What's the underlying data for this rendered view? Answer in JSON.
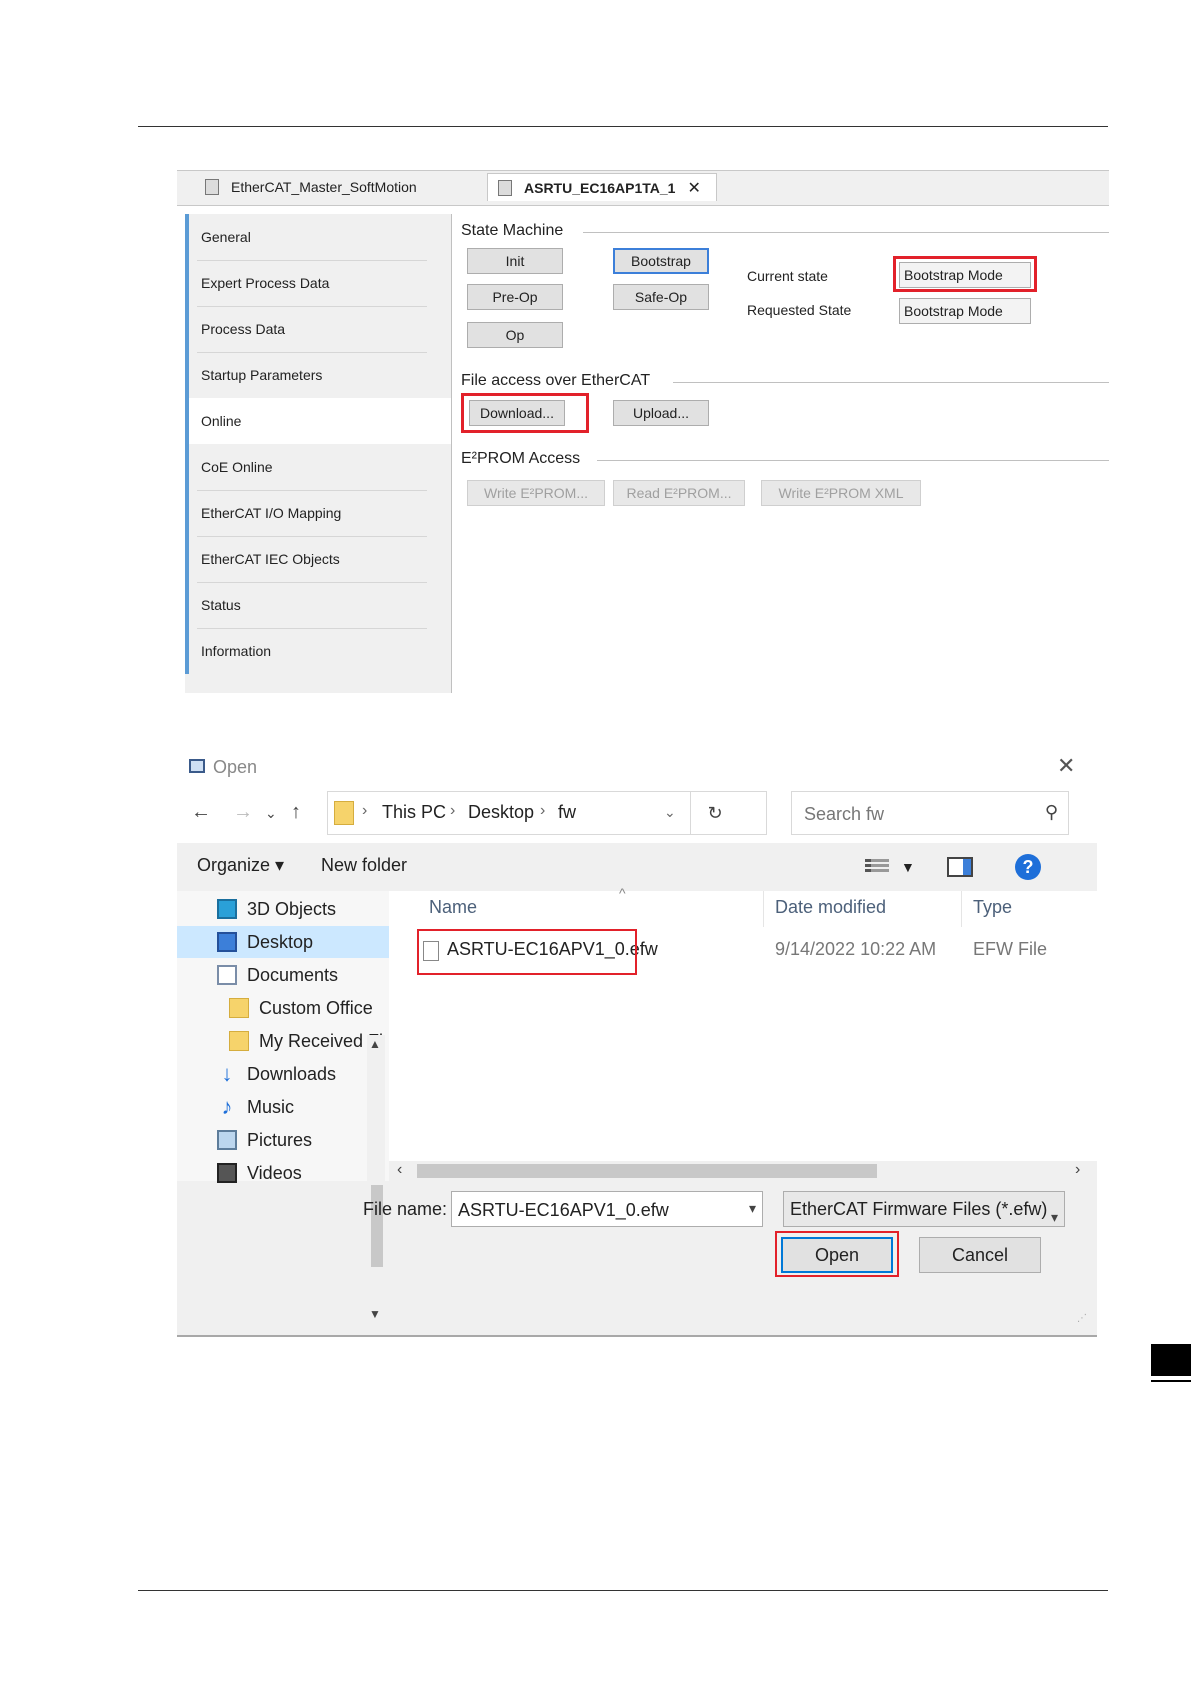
{
  "top_screenshot": {
    "tabs": [
      {
        "label": "EtherCAT_Master_SoftMotion"
      },
      {
        "label": "ASRTU_EC16AP1TA_1",
        "close": "✕"
      }
    ],
    "nav_items": [
      {
        "label": "General"
      },
      {
        "label": "Expert Process Data"
      },
      {
        "label": "Process Data"
      },
      {
        "label": "Startup Parameters"
      },
      {
        "label": "Online"
      },
      {
        "label": "CoE Online"
      },
      {
        "label": "EtherCAT I/O Mapping"
      },
      {
        "label": "EtherCAT IEC Objects"
      },
      {
        "label": "Status"
      },
      {
        "label": "Information"
      }
    ],
    "state_machine": {
      "title": "State Machine",
      "buttons": [
        "Init",
        "Bootstrap",
        "Pre-Op",
        "Safe-Op",
        "Op"
      ],
      "current_state_label": "Current state",
      "current_state_value": "Bootstrap Mode",
      "requested_state_label": "Requested State",
      "requested_state_value": "Bootstrap Mode"
    },
    "file_access": {
      "title": "File access over EtherCAT",
      "download_label": "Download...",
      "upload_label": "Upload..."
    },
    "eeprom": {
      "title": "E²PROM Access",
      "write_label": "Write E²PROM...",
      "read_label": "Read E²PROM...",
      "write_xml_label": "Write E²PROM XML"
    }
  },
  "open_dialog": {
    "title": "Open",
    "breadcrumb": [
      "This PC",
      "Desktop",
      "fw"
    ],
    "search_placeholder": "Search fw",
    "toolbar": {
      "organize": "Organize ▾",
      "new_folder": "New folder"
    },
    "tree": [
      {
        "label": "3D Objects",
        "icon": "3d-objects-icon"
      },
      {
        "label": "Desktop",
        "icon": "desktop-icon",
        "selected": true
      },
      {
        "label": "Documents",
        "icon": "documents-icon"
      },
      {
        "label": "Custom Office",
        "icon": "folder-icon"
      },
      {
        "label": "My Received Fi",
        "icon": "folder-icon"
      },
      {
        "label": "Downloads",
        "icon": "downloads-icon"
      },
      {
        "label": "Music",
        "icon": "music-icon"
      },
      {
        "label": "Pictures",
        "icon": "pictures-icon"
      },
      {
        "label": "Videos",
        "icon": "videos-icon"
      }
    ],
    "columns": [
      "Name",
      "Date modified",
      "Type"
    ],
    "files": [
      {
        "name": "ASRTU-EC16APV1_0.efw",
        "date": "9/14/2022 10:22 AM",
        "type": "EFW File"
      }
    ],
    "file_name_label": "File name:",
    "file_name_value": "ASRTU-EC16APV1_0.efw",
    "file_type": "EtherCAT Firmware Files (*.efw)",
    "open_label": "Open",
    "cancel_label": "Cancel"
  },
  "colors": {
    "highlight": "#e2212a",
    "accent": "#3c7fd9",
    "selection": "#cce8ff"
  }
}
